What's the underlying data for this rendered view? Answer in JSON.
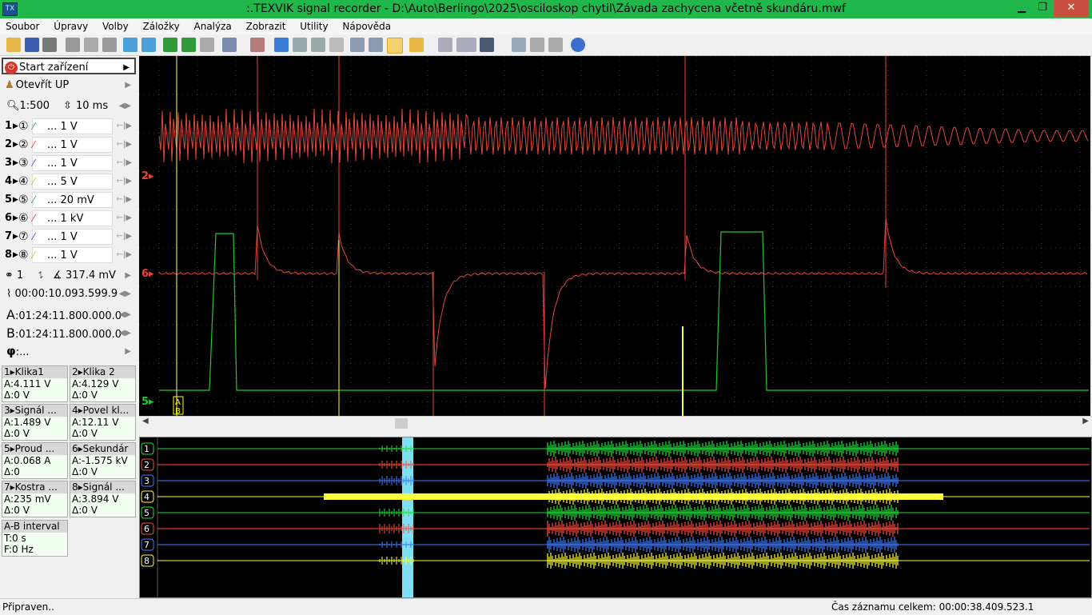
{
  "window": {
    "title": ":.TEXVIK  signal recorder - D:\\Auto\\Berlingo\\2025\\osciloskop chytil\\Závada zachycena včetně skundáru.mwf",
    "app_icon_text": "TX",
    "minimize": "▁",
    "restore": "❐",
    "close": "✕"
  },
  "menu": [
    "Soubor",
    "Úpravy",
    "Volby",
    "Záložky",
    "Analýza",
    "Zobrazit",
    "Utility",
    "Nápověda"
  ],
  "toolbar_icons": [
    "open-icon",
    "save-icon",
    "print-icon",
    "copy-icon",
    "paste-icon",
    "wand-icon",
    "cursor-icon",
    "marker-icon",
    "wave-icon",
    "wave2-icon",
    "undo-icon",
    "zoom-icon",
    "delete-icon",
    "check-icon",
    "check2-icon",
    "check3-icon",
    "page-icon",
    "grid-icon",
    "grid2-icon",
    "active-icon",
    "folder-icon",
    "abc-icon",
    "play-icon",
    "stop-icon",
    "display-icon",
    "chart-icon",
    "page2-icon",
    "cross-icon",
    "help-icon"
  ],
  "left": {
    "start": "Start zařízení",
    "open": "Otevřít UP",
    "zoom": "1:500",
    "time": "10 ms",
    "channels": [
      {
        "num": "1",
        "circle": "①",
        "value": "... 1 V"
      },
      {
        "num": "2",
        "circle": "②",
        "value": "... 1 V"
      },
      {
        "num": "3",
        "circle": "③",
        "value": "... 1 V"
      },
      {
        "num": "4",
        "circle": "④",
        "value": "... 5 V"
      },
      {
        "num": "5",
        "circle": "⑤",
        "value": "... 20 mV"
      },
      {
        "num": "6",
        "circle": "⑥",
        "value": "... 1 kV"
      },
      {
        "num": "7",
        "circle": "⑦",
        "value": "... 1 V"
      },
      {
        "num": "8",
        "circle": "⑧",
        "value": "... 1 V"
      }
    ],
    "trigger_channel": "1",
    "trigger_level": "317.4 mV",
    "trigger_time": "00:00:10.093.599.9",
    "cursor_a_label": "A",
    "cursor_a": ":01:24:11.800.000.0",
    "cursor_b_label": "B",
    "cursor_b": ":01:24:11.800.000.0",
    "phi_label": "φ",
    "phi": ":..."
  },
  "measurements": [
    {
      "hdr": "1▸Klika1",
      "a": "A:4.111 V",
      "d": "Δ:0 V"
    },
    {
      "hdr": "2▸Klika 2",
      "a": "A:4.129 V",
      "d": "Δ:0 V"
    },
    {
      "hdr": "3▸Signál ...",
      "a": "A:1.489 V",
      "d": "Δ:0 V"
    },
    {
      "hdr": "4▸Povel kl...",
      "a": "A:12.11 V",
      "d": "Δ:0 V"
    },
    {
      "hdr": "5▸Proud ...",
      "a": "A:0.068 A",
      "d": "Δ:0"
    },
    {
      "hdr": "6▸Sekundár",
      "a": "A:-1.575 kV",
      "d": "Δ:0 V"
    },
    {
      "hdr": "7▸Kostra ...",
      "a": "A:235 mV",
      "d": "Δ:0 V"
    },
    {
      "hdr": "8▸Signál ...",
      "a": "A:3.894 V",
      "d": "Δ:0 V"
    }
  ],
  "ab_interval": {
    "hdr": "A-B interval",
    "t": "T:0 s",
    "f": "F:0 Hz"
  },
  "scope": {
    "ch2_label": "2▸",
    "ch6_label": "6▸",
    "ch5_label": "5▸",
    "cursor_a": "A",
    "cursor_b": "B",
    "colors": {
      "red": "#e8443a",
      "green": "#22c534",
      "yellow": "#ffff3a",
      "blue": "#3f7bff",
      "grid": "#3a3a3a"
    }
  },
  "overview": {
    "labels": [
      "1",
      "2",
      "3",
      "4",
      "5",
      "6",
      "7",
      "8"
    ],
    "colors": [
      "#22e13a",
      "#ff4b3a",
      "#3f7bff",
      "#ffff3a",
      "#22e13a",
      "#ff4b3a",
      "#3f7bff",
      "#ffff3a"
    ]
  },
  "status": {
    "left": "Připraven..",
    "right": "Čas záznamu celkem: 00:00:38.409.523.1"
  }
}
